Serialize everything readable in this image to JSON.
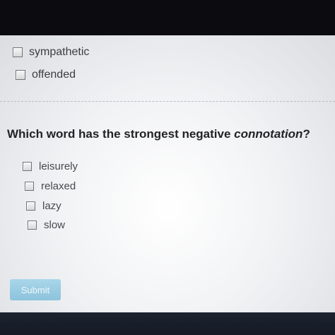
{
  "previous_question": {
    "options": [
      {
        "label": "sympathetic"
      },
      {
        "label": "offended"
      }
    ]
  },
  "question": {
    "prefix": "Which word has the strongest negative ",
    "emphasis": "connotation",
    "suffix": "?",
    "options": [
      {
        "label": "leisurely"
      },
      {
        "label": "relaxed"
      },
      {
        "label": "lazy"
      },
      {
        "label": "slow"
      }
    ]
  },
  "actions": {
    "submit_label": "Submit"
  },
  "colors": {
    "submit_button": "#9ccde3",
    "background": "#eef0f2",
    "bottom_bar": "#1a1f2b"
  }
}
